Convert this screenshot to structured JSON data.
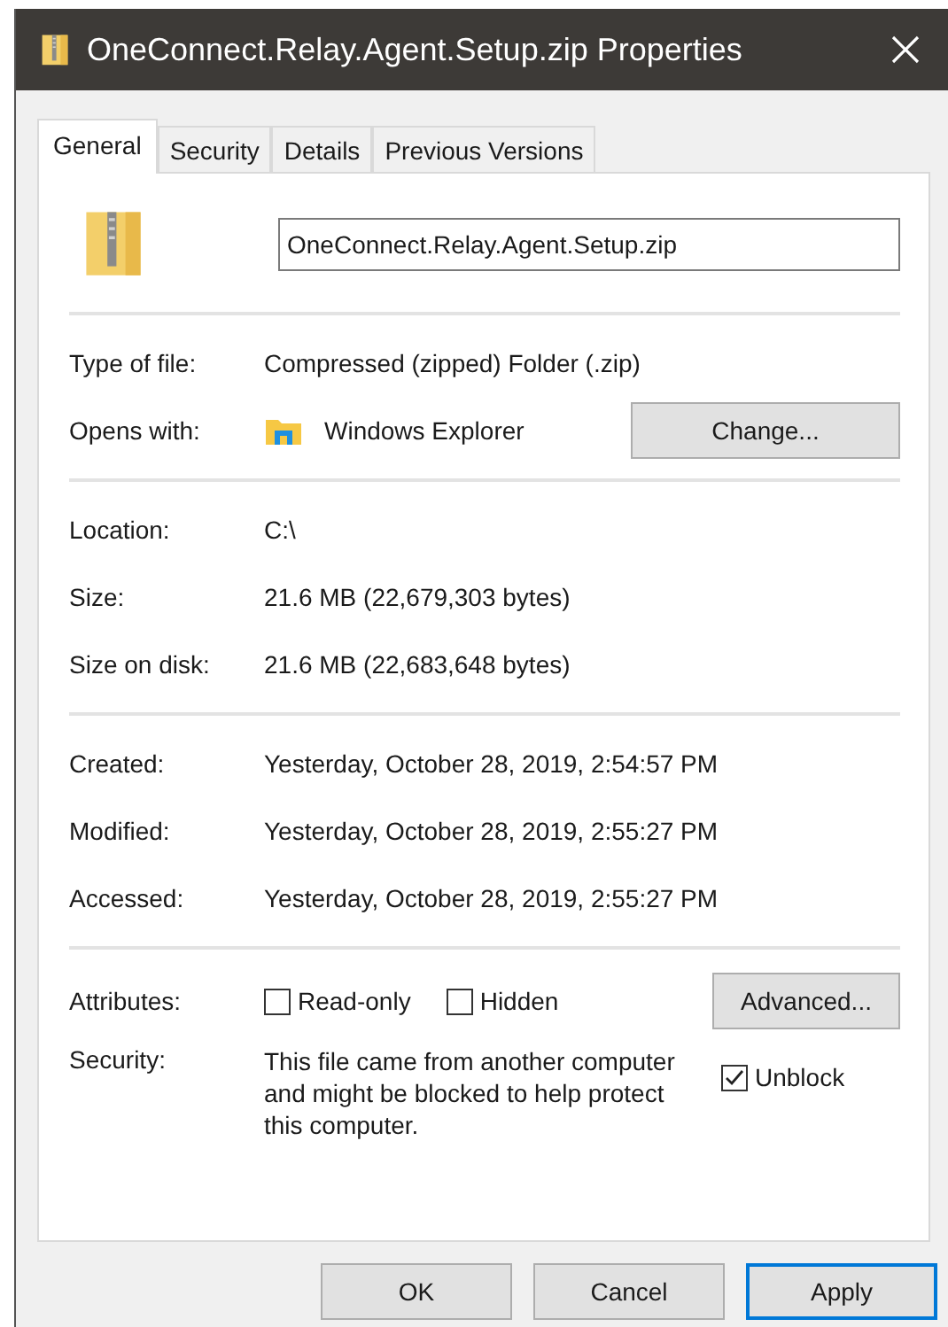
{
  "window": {
    "title": "OneConnect.Relay.Agent.Setup.zip Properties"
  },
  "tabs": [
    {
      "label": "General",
      "selected": true
    },
    {
      "label": "Security",
      "selected": false
    },
    {
      "label": "Details",
      "selected": false
    },
    {
      "label": "Previous Versions",
      "selected": false
    }
  ],
  "name_field": {
    "value": "OneConnect.Relay.Agent.Setup.zip"
  },
  "type_section": [
    {
      "kind": "text",
      "label": "Type of file:",
      "value": "Compressed (zipped) Folder (.zip)"
    },
    {
      "kind": "app",
      "label": "Opens with:",
      "value": "Windows Explorer",
      "button": "Change..."
    }
  ],
  "location_section": [
    {
      "label": "Location:",
      "value": "C:\\"
    },
    {
      "label": "Size:",
      "value": "21.6 MB (22,679,303 bytes)"
    },
    {
      "label": "Size on disk:",
      "value": "21.6 MB (22,683,648 bytes)"
    }
  ],
  "date_section": [
    {
      "label": "Created:",
      "value": "Yesterday, October 28, 2019, 2:54:57 PM"
    },
    {
      "label": "Modified:",
      "value": "Yesterday, October 28, 2019, 2:55:27 PM"
    },
    {
      "label": "Accessed:",
      "value": "Yesterday, October 28, 2019, 2:55:27 PM"
    }
  ],
  "attributes": {
    "label": "Attributes:",
    "checkboxes": [
      {
        "label": "Read-only",
        "checked": false
      },
      {
        "label": "Hidden",
        "checked": false
      }
    ],
    "button": "Advanced..."
  },
  "security": {
    "label": "Security:",
    "text": "This file came from another computer and might be blocked to help protect this computer.",
    "checkbox": {
      "label": "Unblock",
      "checked": true
    }
  },
  "buttons": [
    {
      "label": "OK",
      "default": false
    },
    {
      "label": "Cancel",
      "default": false
    },
    {
      "label": "Apply",
      "default": true
    }
  ]
}
